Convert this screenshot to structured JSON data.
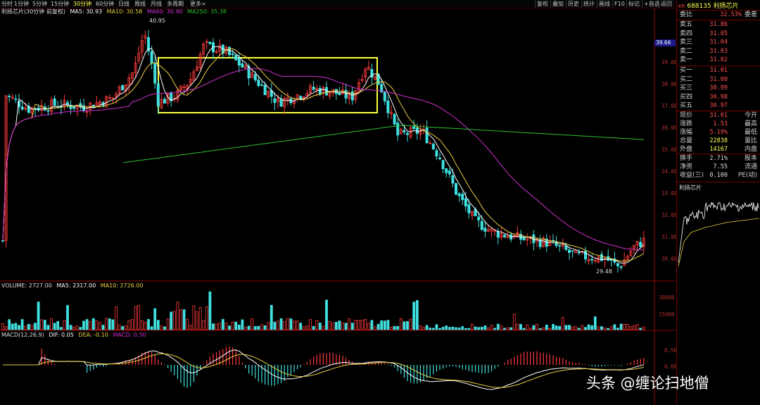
{
  "toolbar": {
    "periods": [
      "分时",
      "1分钟",
      "5分钟",
      "15分钟",
      "30分钟",
      "60分钟",
      "日线",
      "周线",
      "月线",
      "多周期",
      "更多>"
    ],
    "active_period": "30分钟",
    "buttons": [
      "复权",
      "叠加",
      "历史",
      "统计",
      "画线",
      "F10",
      "标记",
      "+自选",
      "返回"
    ]
  },
  "main_chart": {
    "title": "利扬芯片(30分钟 前复权)",
    "ma5": "MA5: 30.93",
    "ma10": "MA10: 30.58",
    "ma60": "MA60: 30.90",
    "ma250": "MA250: 35.38",
    "high_label": "40.95",
    "low_label": "29.48",
    "current_price_tag": "39.66",
    "y_ticks": [
      "39.00",
      "38.00",
      "37.00",
      "36.00",
      "35.00",
      "34.00",
      "33.00",
      "32.00",
      "31.00",
      "30.00"
    ]
  },
  "volume_chart": {
    "label": "VOLUME: 2727.00",
    "ma5": "MA5: 2317.00",
    "ma10": "MA10: 2726.00",
    "y_ticks": [
      "30000",
      "15000"
    ]
  },
  "macd_chart": {
    "label": "MACD(12,26,9)",
    "dif": "DIF: 0.05",
    "dea": "DEA: -0.10",
    "macd": "MACD: 0.30",
    "y_ticks": [
      "0.50",
      "0.00"
    ]
  },
  "quote_panel": {
    "code": "688135",
    "name": "利扬芯片",
    "kr": "KR",
    "weibi_label": "委比",
    "weibi_value": "32.53%",
    "weicha_label": "委差",
    "asks": [
      {
        "label": "卖五",
        "price": "31.86"
      },
      {
        "label": "卖四",
        "price": "31.05"
      },
      {
        "label": "卖三",
        "price": "31.04"
      },
      {
        "label": "卖二",
        "price": "31.03"
      },
      {
        "label": "卖一",
        "price": "31.02"
      }
    ],
    "bids": [
      {
        "label": "买一",
        "price": "31.01"
      },
      {
        "label": "买二",
        "price": "31.00"
      },
      {
        "label": "买三",
        "price": "30.99"
      },
      {
        "label": "买四",
        "price": "30.98"
      },
      {
        "label": "买五",
        "price": "30.97"
      }
    ],
    "stats": [
      {
        "l1": "现价",
        "v1": "31.01",
        "l2": "今开"
      },
      {
        "l1": "涨跌",
        "v1": "1.53",
        "l2": "最高"
      },
      {
        "l1": "涨幅",
        "v1": "5.19%",
        "l2": "最低"
      },
      {
        "l1": "总量",
        "v1": "22838",
        "l2": "量比"
      },
      {
        "l1": "外盘",
        "v1": "14167",
        "l2": "内盘"
      }
    ],
    "stats2": [
      {
        "l1": "换手",
        "v1": "2.71%",
        "l2": "股本"
      },
      {
        "l1": "净资",
        "v1": "7.55",
        "l2": "流通"
      },
      {
        "l1": "收益(三)",
        "v1": "0.100",
        "l2": "PE(动)"
      }
    ],
    "mini_title": "利扬芯片"
  },
  "watermark": "头条 @缠论扫地僧",
  "colors": {
    "up": "#ff3b3b",
    "down": "#40e0e0",
    "ma5": "#ffffff",
    "ma10": "#e8d040",
    "ma60": "#d030d0",
    "ma250": "#30c030",
    "box": "#ffff40"
  }
}
